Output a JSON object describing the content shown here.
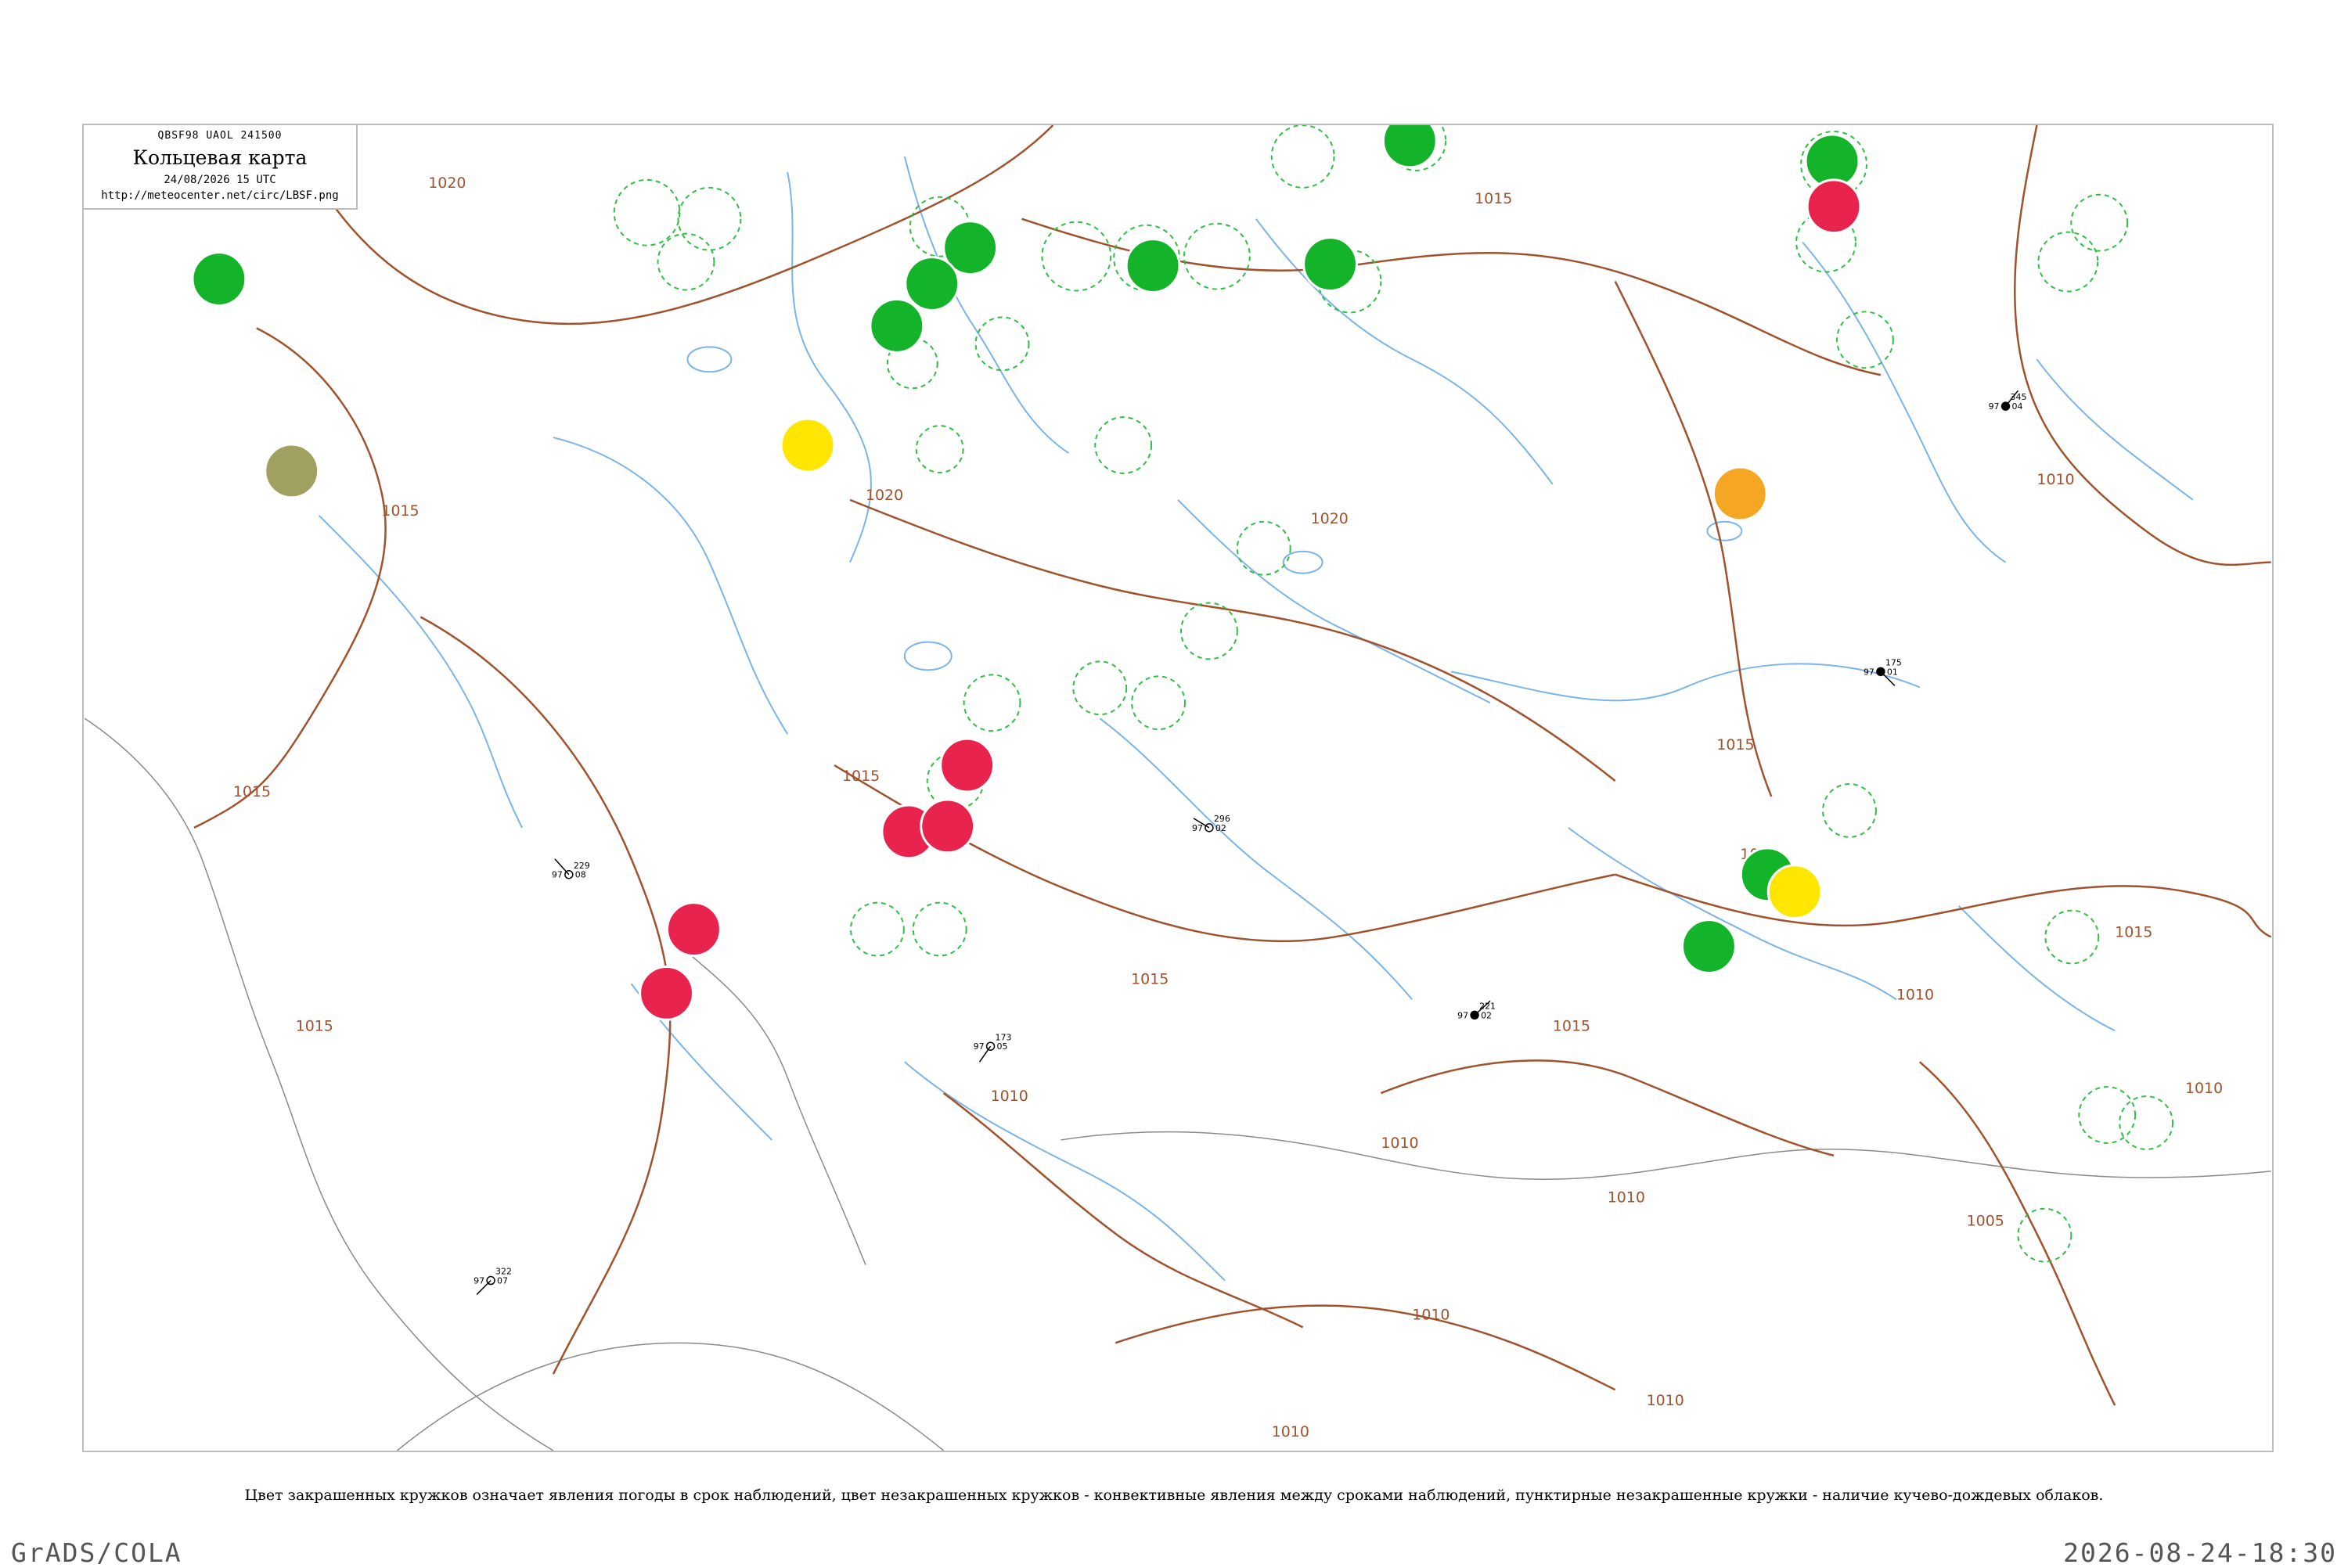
{
  "header": {
    "code_line": "QBSF98  UAOL  241500",
    "title": "Кольцевая карта",
    "datetime": "24/08/2026 15 UTC",
    "url": "http://meteocenter.net/circ/LBSF.png"
  },
  "caption": "Цвет закрашенных кружков означает явления погоды в срок наблюдений, цвет незакрашенных кружков - конвективные явления между сроками наблюдений, пунктирные незакрашенные кружки - наличие кучево-дождевых облаков.",
  "footer": {
    "left": "GrADS/COLA",
    "right": "2026-08-24-18:30"
  },
  "isobar_labels": [
    "1020",
    "1015",
    "1020",
    "1015",
    "1020",
    "1015",
    "1015",
    "1010",
    "1015",
    "1015",
    "1015",
    "1015",
    "1010",
    "1010",
    "1015",
    "1015",
    "1010",
    "1010",
    "1010",
    "1005",
    "1010",
    "1010",
    "1010"
  ],
  "station_plots": [
    {
      "pressure": "229",
      "value": "97",
      "cover": "08"
    },
    {
      "pressure": "221",
      "value": "97",
      "cover": "02"
    },
    {
      "pressure": "173",
      "value": "97",
      "cover": "05"
    },
    {
      "pressure": "175",
      "value": "97",
      "cover": "01"
    },
    {
      "pressure": "296",
      "value": "97",
      "cover": "02"
    },
    {
      "pressure": "345",
      "value": "97",
      "cover": "04"
    },
    {
      "pressure": "322",
      "value": "97",
      "cover": "07"
    }
  ],
  "colors": {
    "isobar": "#a0522d",
    "river": "#7ab4e8",
    "green_event": "#13b32a",
    "red_event": "#e8234e",
    "yellow_event": "#ffe600",
    "orange_event": "#f5a623",
    "olive_event": "#a0a060",
    "station": "#000000",
    "frame": "#bdbdbd"
  }
}
